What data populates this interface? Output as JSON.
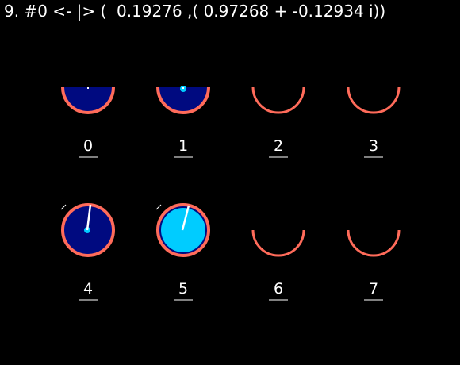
{
  "header": {
    "text": "9. #0 <- |> (  0.19276 ,( 0.97268 + -0.12934 i))"
  },
  "colors": {
    "background": "#000000",
    "ring": "#ff6b5a",
    "dark_fill": "#000a80",
    "bright_fill": "#00ccff",
    "dot": "#00ccff",
    "needle": "#ffffff",
    "label": "#ffffff"
  },
  "qubits": [
    {
      "label": "0",
      "state": "clipped-dark"
    },
    {
      "label": "1",
      "state": "clipped-dark-dot"
    },
    {
      "label": "2",
      "state": "empty"
    },
    {
      "label": "3",
      "state": "empty"
    },
    {
      "label": "4",
      "state": "dark-needle"
    },
    {
      "label": "5",
      "state": "bright-needle"
    },
    {
      "label": "6",
      "state": "empty"
    },
    {
      "label": "7",
      "state": "empty"
    }
  ]
}
